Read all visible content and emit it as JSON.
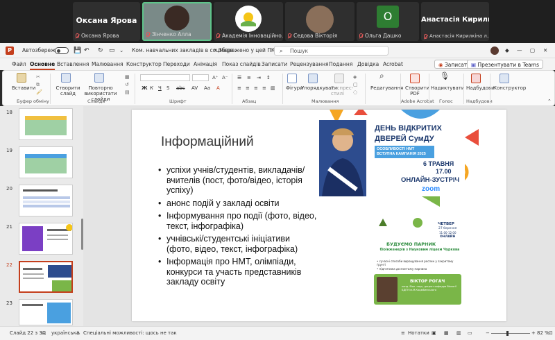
{
  "teams": {
    "tiles": [
      {
        "big": "Оксана Ярова",
        "caption": "Оксана Ярова"
      },
      {
        "big": "",
        "caption": "Зінченко Алла"
      },
      {
        "big": "",
        "caption": "Академія Інноваційно..."
      },
      {
        "big": "",
        "caption": "Седова Вікторія"
      },
      {
        "big": "O",
        "caption": "Ольга Дашко"
      },
      {
        "big": "Анастасія Кирилкіна",
        "caption": "Анастасія Кирилкіна л..."
      }
    ],
    "colors": {
      "active_tile": "#5ec48a",
      "avatar_o": "#2e7d32"
    }
  },
  "titlebar": {
    "autosave": "Автозбереження",
    "doc_title": "Ком. навчальних закладів в соцмере...",
    "saved": "• Збережено у цей ПК ⌄",
    "search_placeholder": "Пошук"
  },
  "menu": {
    "tabs": [
      "Файл",
      "Основне",
      "Вставлення",
      "Малювання",
      "Конструктор",
      "Переходи",
      "Анімація",
      "Показ слайдів",
      "Записати",
      "Рецензування",
      "Подання",
      "Довідка",
      "Acrobat"
    ],
    "active": "Основне",
    "record_btn": "Записати",
    "present_btn": "Презентувати в Teams"
  },
  "ribbon": {
    "paste": "Вставити",
    "clipboard": "Буфер обміну",
    "new_slide": "Створити слайд",
    "reuse": "Повторно використати слайди",
    "slides": "Слайди",
    "font": "Шрифт",
    "paragraph": "Абзац",
    "shapes": "Фігури",
    "arrange": "Упорядкувати",
    "quick_styles": "Експрес-стилі",
    "drawing": "Малювання",
    "editing": "Редагування",
    "create_pdf": "Створити PDF",
    "acrobat": "Adobe Acrobat",
    "dictate": "Надиктувати",
    "voice": "Голос",
    "designer": "Надбудови",
    "addins": "Надбудови",
    "constructor": "Конструктор"
  },
  "thumbnails": [
    {
      "num": "18"
    },
    {
      "num": "19"
    },
    {
      "num": "20"
    },
    {
      "num": "21"
    },
    {
      "num": "22",
      "selected": true
    },
    {
      "num": "23"
    }
  ],
  "slide": {
    "title": "Інформаційний",
    "bullets": [
      "успіхи учнів/студентів, викладачів/вчителів (пост, фото/відео, історія успіху)",
      "анонс подій у закладі освіти",
      "Інформування про події (фото, відео, текст, інфографіка)",
      "учнівські/студентські ініціативи (фото, відео, текст, інфографіка)",
      "Інформація про НМТ, олімпіади, конкурси та участь представників закладу освіту"
    ],
    "poster1": {
      "line1": "ДЕНЬ ВІДКРИТИХ",
      "line2": "ДВЕРЕЙ СумДУ",
      "tag": "ОСОБЛИВОСТІ НМТ ВСТУПНА КАМПАНІЯ 2025",
      "date": "6 ТРАВНЯ",
      "time": "17.00",
      "online": "ОНЛАЙН-ЗУСТРІЧ",
      "zoom": "zoom"
    },
    "poster2": {
      "day": "ЧЕТВЕР",
      "date": "27 березня",
      "time": "11:00-12:00",
      "mode": "ОНЛАЙН",
      "heading": "БУДУЄМО ПАРНИК",
      "sub": "біоінженерів з Науковим ліцеєм Чуркова",
      "b1": "• сучасні способи вирощування рослин у закритому ґрунті",
      "b2": "• підготовка до монтажу парника",
      "speaker": "ВІКТОР РОГАЧ",
      "speaker_role": "канд. біол. наук, доцент кафедри біології БДПУ ім.М.Коцюбинського"
    }
  },
  "status": {
    "slide": "Слайд 22 з 34",
    "lang": "українська",
    "accessibility": "Спеціальні можливості: щось не так",
    "notes": "Нотатки",
    "zoom": "82 %"
  }
}
